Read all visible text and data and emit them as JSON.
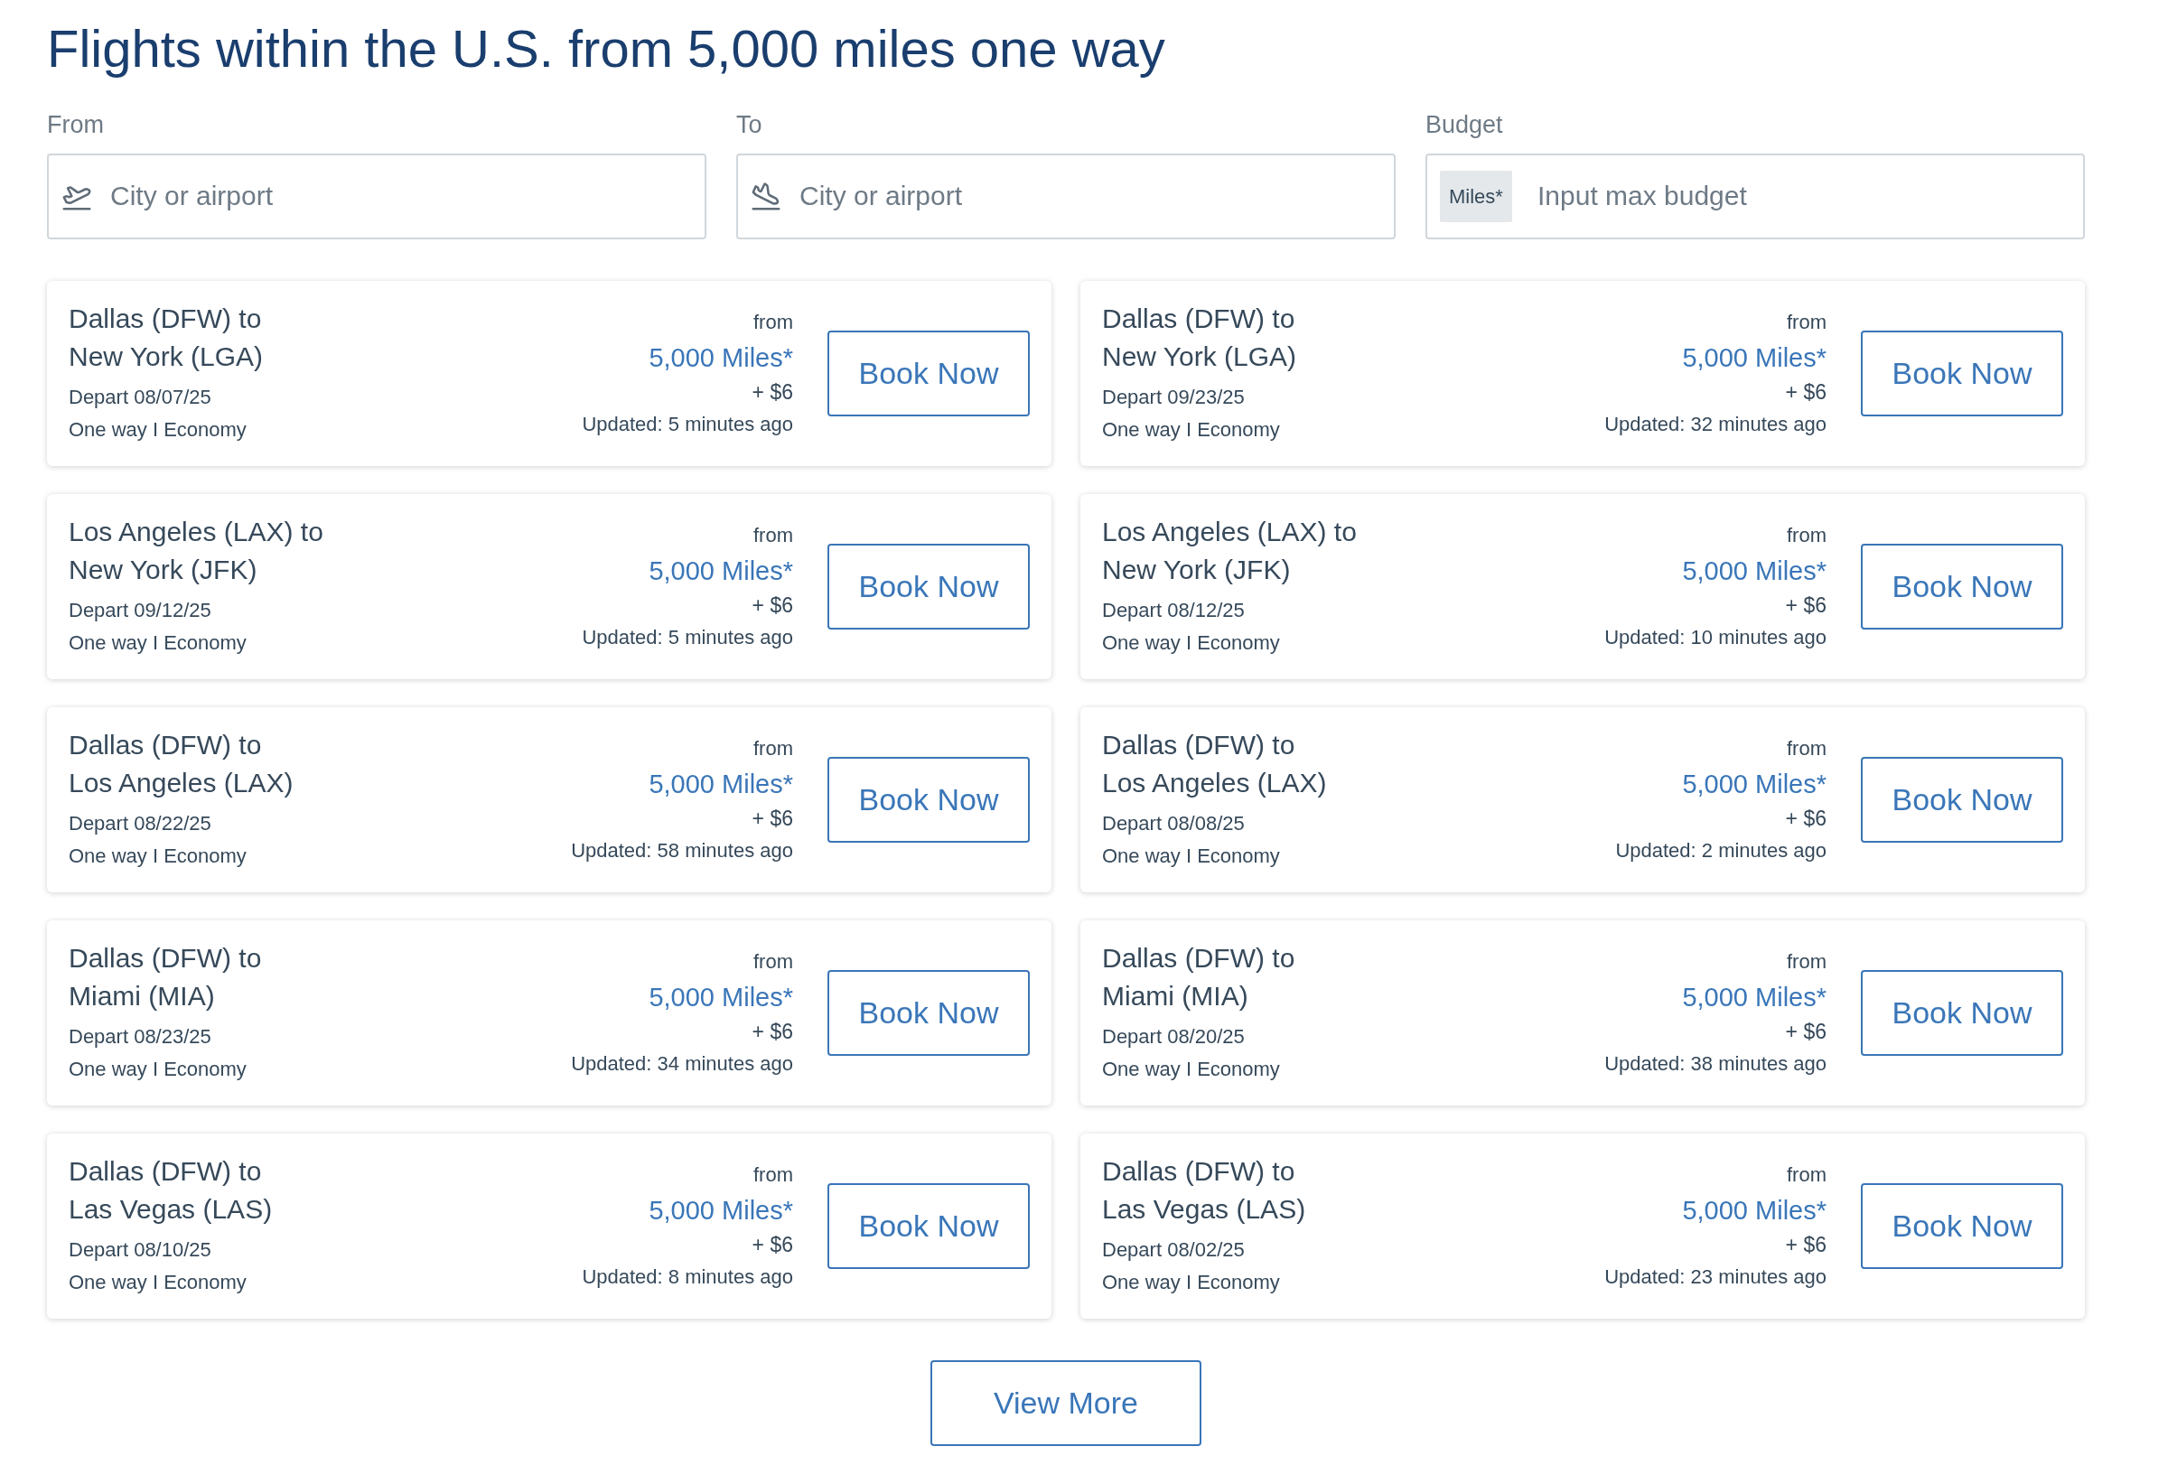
{
  "title": "Flights within the U.S. from 5,000 miles one way",
  "fields": [
    {
      "kind": "departure",
      "label": "From",
      "placeholder": "City or airport"
    },
    {
      "kind": "arrival",
      "label": "To",
      "placeholder": "City or airport"
    },
    {
      "kind": "budget",
      "label": "Budget",
      "prefix": "Miles*",
      "placeholder": "Input max budget"
    }
  ],
  "flights": [
    {
      "route": [
        "Dallas (DFW) to",
        "New York (LGA)"
      ],
      "depart": "Depart 08/07/25",
      "trip": "One way I Economy",
      "from": "from",
      "miles": "5,000 Miles*",
      "fee": "+ $6",
      "updated": "Updated: 5 minutes ago",
      "button": "Book Now"
    },
    {
      "route": [
        "Dallas (DFW) to",
        "New York (LGA)"
      ],
      "depart": "Depart 09/23/25",
      "trip": "One way I Economy",
      "from": "from",
      "miles": "5,000 Miles*",
      "fee": "+ $6",
      "updated": "Updated: 32 minutes ago",
      "button": "Book Now"
    },
    {
      "route": [
        "Los Angeles (LAX) to",
        "New York (JFK)"
      ],
      "depart": "Depart 09/12/25",
      "trip": "One way I Economy",
      "from": "from",
      "miles": "5,000 Miles*",
      "fee": "+ $6",
      "updated": "Updated: 5 minutes ago",
      "button": "Book Now"
    },
    {
      "route": [
        "Los Angeles (LAX) to",
        "New York (JFK)"
      ],
      "depart": "Depart 08/12/25",
      "trip": "One way I Economy",
      "from": "from",
      "miles": "5,000 Miles*",
      "fee": "+ $6",
      "updated": "Updated: 10 minutes ago",
      "button": "Book Now"
    },
    {
      "route": [
        "Dallas (DFW) to",
        "Los Angeles (LAX)"
      ],
      "depart": "Depart 08/22/25",
      "trip": "One way I Economy",
      "from": "from",
      "miles": "5,000 Miles*",
      "fee": "+ $6",
      "updated": "Updated: 58 minutes ago",
      "button": "Book Now"
    },
    {
      "route": [
        "Dallas (DFW) to",
        "Los Angeles (LAX)"
      ],
      "depart": "Depart 08/08/25",
      "trip": "One way I Economy",
      "from": "from",
      "miles": "5,000 Miles*",
      "fee": "+ $6",
      "updated": "Updated: 2 minutes ago",
      "button": "Book Now"
    },
    {
      "route": [
        "Dallas (DFW) to",
        "Miami (MIA)"
      ],
      "depart": "Depart 08/23/25",
      "trip": "One way I Economy",
      "from": "from",
      "miles": "5,000 Miles*",
      "fee": "+ $6",
      "updated": "Updated: 34 minutes ago",
      "button": "Book Now"
    },
    {
      "route": [
        "Dallas (DFW) to",
        "Miami (MIA)"
      ],
      "depart": "Depart 08/20/25",
      "trip": "One way I Economy",
      "from": "from",
      "miles": "5,000 Miles*",
      "fee": "+ $6",
      "updated": "Updated: 38 minutes ago",
      "button": "Book Now"
    },
    {
      "route": [
        "Dallas (DFW) to",
        "Las Vegas (LAS)"
      ],
      "depart": "Depart 08/10/25",
      "trip": "One way I Economy",
      "from": "from",
      "miles": "5,000 Miles*",
      "fee": "+ $6",
      "updated": "Updated: 8 minutes ago",
      "button": "Book Now"
    },
    {
      "route": [
        "Dallas (DFW) to",
        "Las Vegas (LAS)"
      ],
      "depart": "Depart 08/02/25",
      "trip": "One way I Economy",
      "from": "from",
      "miles": "5,000 Miles*",
      "fee": "+ $6",
      "updated": "Updated: 23 minutes ago",
      "button": "Book Now"
    }
  ],
  "view_more": "View More"
}
